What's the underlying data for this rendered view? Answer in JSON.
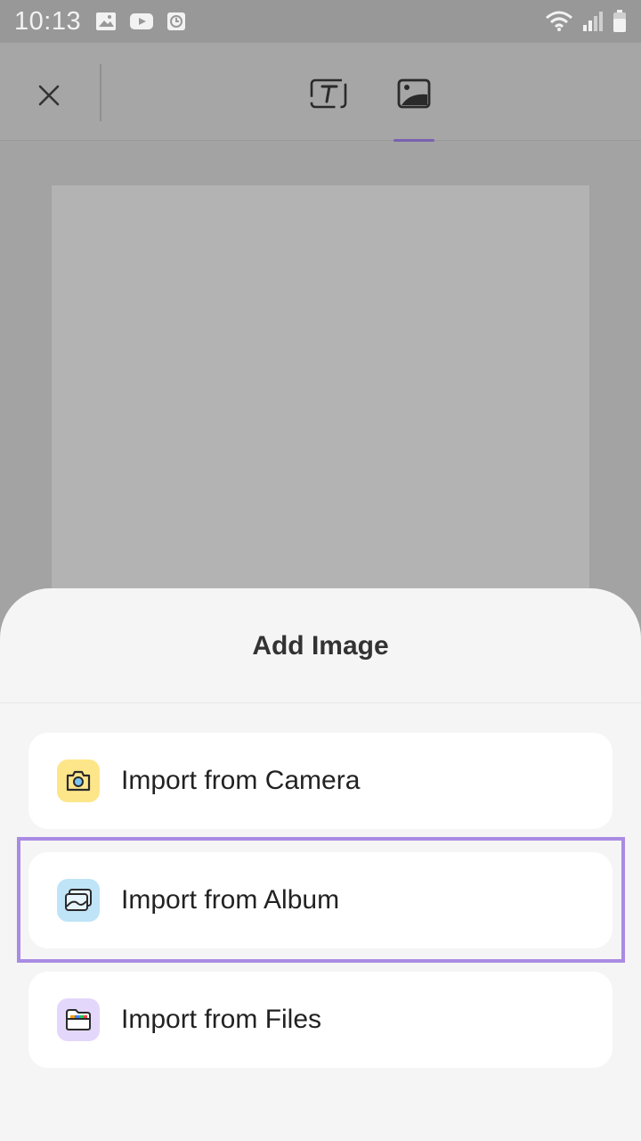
{
  "status_bar": {
    "time": "10:13",
    "left_icons": [
      "gallery-icon",
      "youtube-icon",
      "clock-icon"
    ],
    "right_icons": [
      "wifi-icon",
      "signal-icon",
      "battery-icon"
    ]
  },
  "toolbar": {
    "close_icon": "close-icon",
    "tabs": [
      {
        "name": "text",
        "icon": "text-box-icon",
        "selected": false
      },
      {
        "name": "image",
        "icon": "image-icon",
        "selected": true
      }
    ],
    "accent_color": "#7a60b0"
  },
  "sheet": {
    "title": "Add Image",
    "options": [
      {
        "label": "Import from Camera",
        "icon": "camera-icon",
        "icon_bg": "#fde68a"
      },
      {
        "label": "Import from Album",
        "icon": "album-icon",
        "icon_bg": "#bfe3f7",
        "highlighted": true
      },
      {
        "label": "Import from Files",
        "icon": "folder-icon",
        "icon_bg": "#e3d7fb"
      }
    ],
    "highlight_color": "#a98be3"
  }
}
